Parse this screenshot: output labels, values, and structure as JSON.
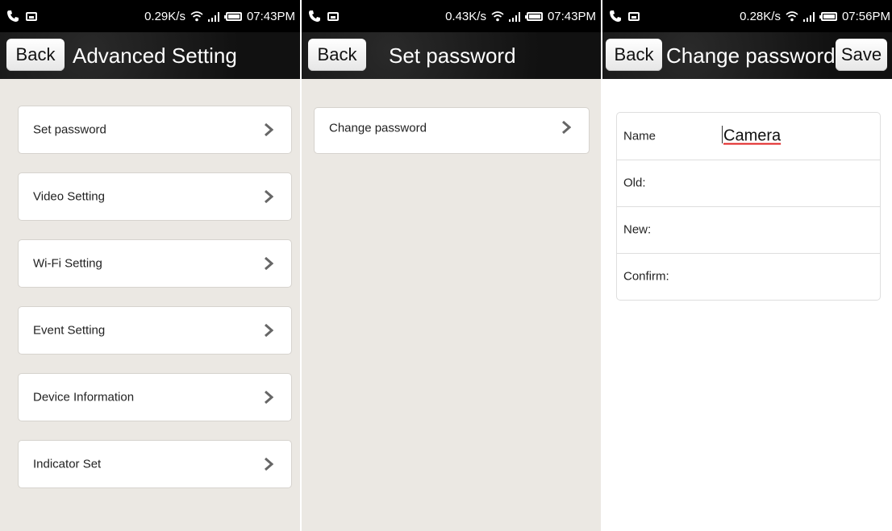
{
  "colors": {
    "page_bg": "#ebe8e3",
    "card_bg": "#ffffff",
    "titlebar_bg": "#111111",
    "chevron": "#666666",
    "spellcheck_underline": "#e02020"
  },
  "icons": {
    "status_left": [
      "phone-call-icon",
      "image-notification-icon"
    ],
    "status_right": [
      "wifi-icon",
      "signal-icon",
      "battery-icon"
    ],
    "menu_arrow": "chevron-right-icon"
  },
  "screens": [
    {
      "status": {
        "speed": "0.29K/s",
        "time": "07:43PM"
      },
      "header": {
        "back_label": "Back",
        "title": "Advanced Setting"
      },
      "menu_items": [
        {
          "label": "Set password"
        },
        {
          "label": "Video Setting"
        },
        {
          "label": "Wi-Fi Setting"
        },
        {
          "label": "Event Setting"
        },
        {
          "label": "Device Information"
        },
        {
          "label": "Indicator Set"
        }
      ]
    },
    {
      "status": {
        "speed": "0.43K/s",
        "time": "07:43PM"
      },
      "header": {
        "back_label": "Back",
        "title": "Set password"
      },
      "menu_items": [
        {
          "label": "Change password"
        }
      ]
    },
    {
      "status": {
        "speed": "0.28K/s",
        "time": "07:56PM"
      },
      "header": {
        "back_label": "Back",
        "title": "Change password",
        "save_label": "Save"
      },
      "form": {
        "name_label": "Name",
        "name_value": "Camera",
        "old_label": "Old:",
        "old_value": "",
        "new_label": "New:",
        "new_value": "",
        "confirm_label": "Confirm:",
        "confirm_value": ""
      }
    }
  ]
}
